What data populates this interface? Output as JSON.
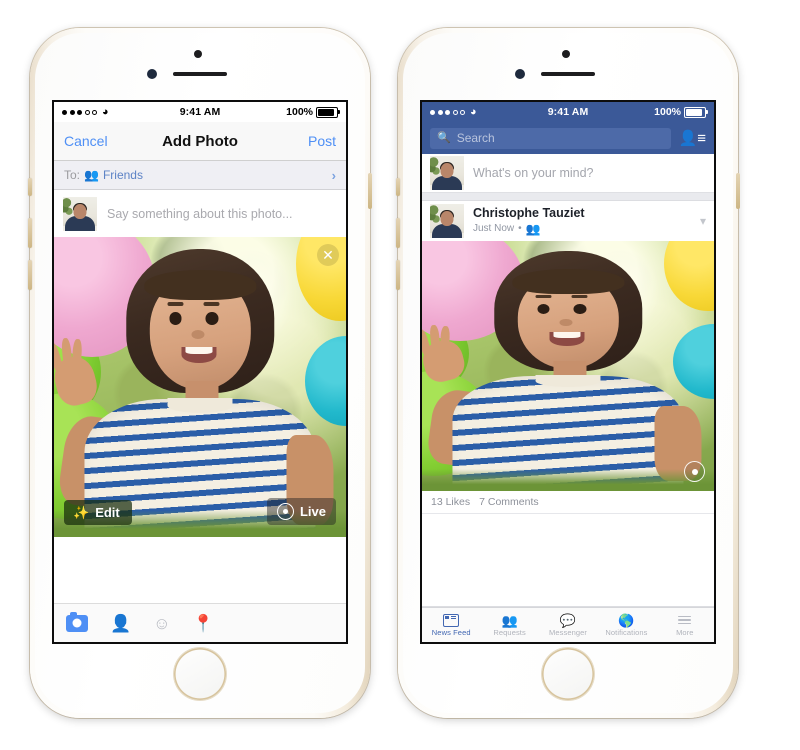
{
  "left_phone": {
    "status_bar": {
      "signal_filled": 3,
      "signal_empty": 2,
      "wifi_icon": "wifi-icon",
      "time": "9:41 AM",
      "battery_percent": "100%"
    },
    "nav_bar": {
      "cancel_label": "Cancel",
      "title": "Add Photo",
      "post_label": "Post"
    },
    "audience_row": {
      "to_label": "To:",
      "audience_icon": "friends-icon",
      "audience_value": "Friends",
      "chevron_icon": "chevron-right-icon"
    },
    "composer": {
      "avatar": "user-avatar",
      "placeholder": "Say something about this photo..."
    },
    "photo": {
      "close_icon": "close-icon",
      "edit_button": {
        "icon": "magic-wand-icon",
        "label": "Edit"
      },
      "live_button": {
        "icon": "live-photo-icon",
        "label": "Live"
      }
    },
    "toolbar_icons": [
      {
        "name": "camera-icon",
        "glyph": "",
        "active": true
      },
      {
        "name": "tag-person-icon",
        "glyph": "⬤"
      },
      {
        "name": "emoji-icon",
        "glyph": "☺"
      },
      {
        "name": "location-pin-icon",
        "glyph": "•"
      }
    ]
  },
  "right_phone": {
    "status_bar": {
      "signal_filled": 3,
      "signal_empty": 2,
      "wifi_icon": "wifi-icon",
      "time": "9:41 AM",
      "battery_percent": "100%"
    },
    "nav_bar": {
      "search_icon": "search-icon",
      "search_placeholder": "Search",
      "requests_icon": "friend-requests-icon"
    },
    "status_composer": {
      "avatar": "user-avatar",
      "placeholder": "What's on your mind?"
    },
    "post": {
      "author": "Christophe Tauziet",
      "timestamp": "Just Now",
      "meta_separator": "•",
      "audience_icon": "friends-icon",
      "caret_icon": "chevron-down-icon",
      "live_badge_icon": "live-photo-icon",
      "likes": "13 Likes",
      "comments": "7 Comments"
    },
    "tab_bar": [
      {
        "label": "News Feed",
        "icon": "news-feed-icon",
        "active": true
      },
      {
        "label": "Requests",
        "icon": "friend-requests-icon",
        "active": false
      },
      {
        "label": "Messenger",
        "icon": "messenger-icon",
        "active": false
      },
      {
        "label": "Notifications",
        "icon": "globe-notifications-icon",
        "active": false
      },
      {
        "label": "More",
        "icon": "hamburger-more-icon",
        "active": false
      }
    ]
  },
  "colors": {
    "facebook_blue": "#3b5998",
    "ios_link_blue": "#4e8ff5",
    "tab_active_blue": "#4267b2",
    "phone_gold": "#dfd0b6"
  }
}
